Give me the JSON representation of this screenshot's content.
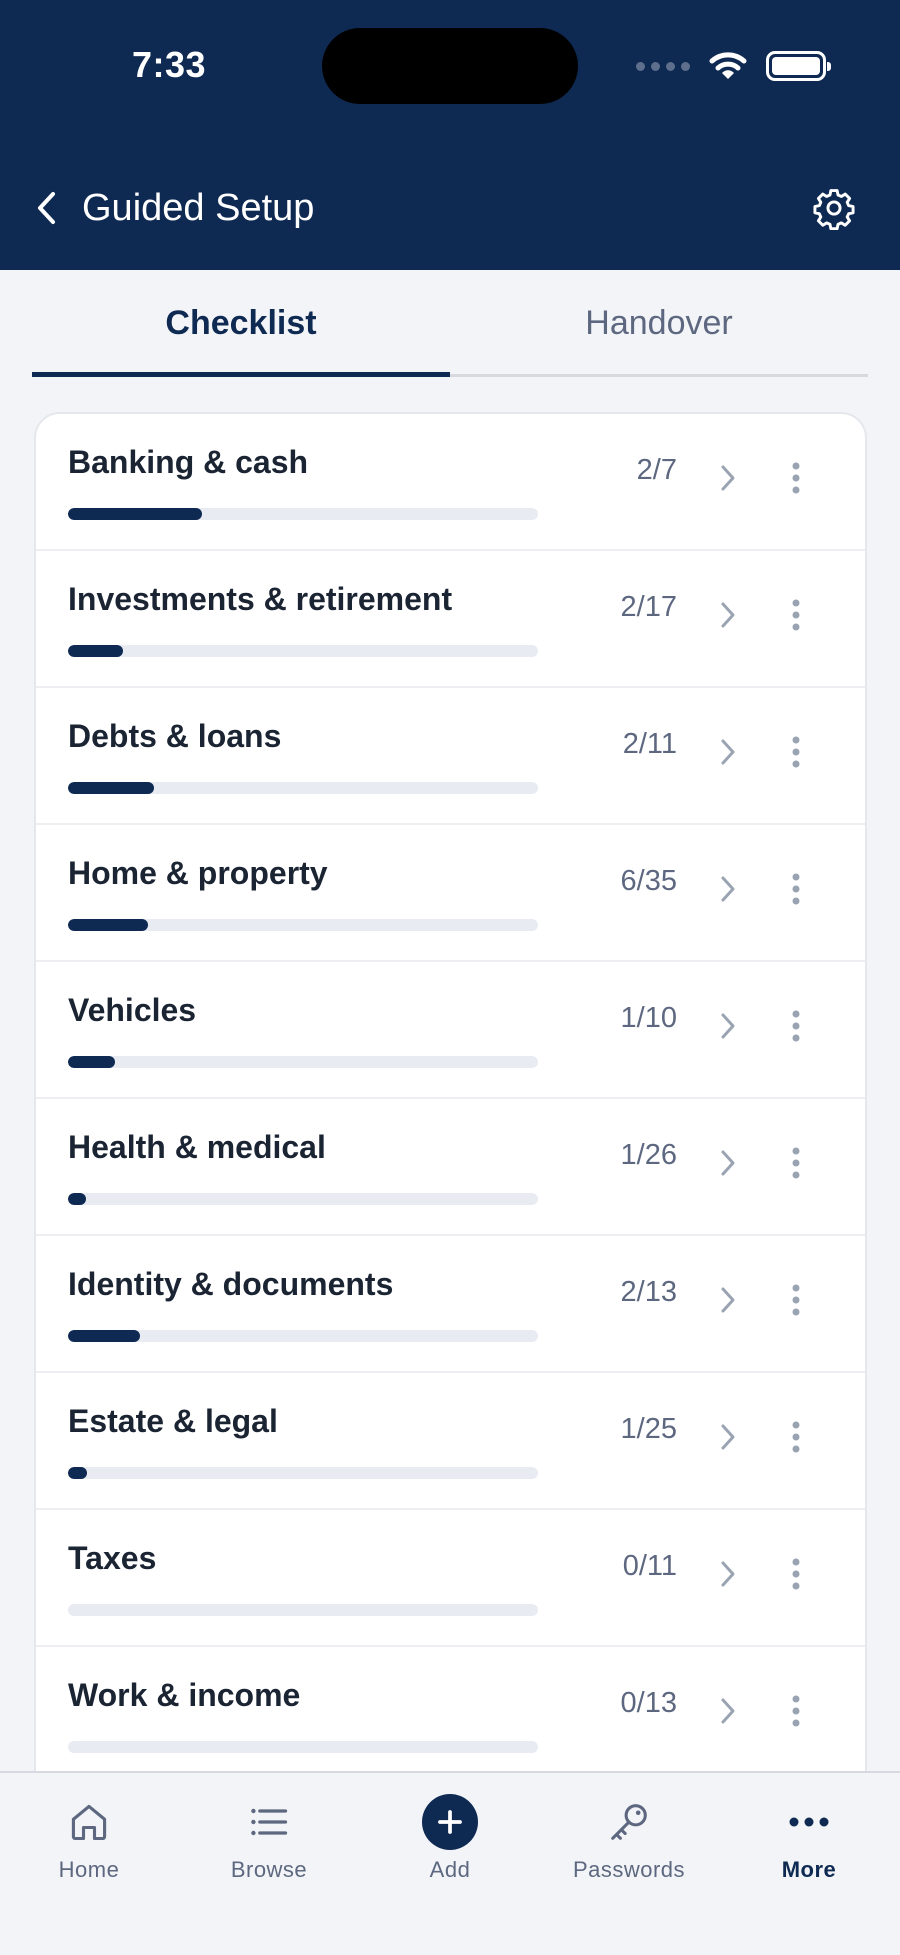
{
  "status_bar": {
    "time": "7:33"
  },
  "header": {
    "title": "Guided Setup"
  },
  "tabs": [
    {
      "label": "Checklist",
      "active": true
    },
    {
      "label": "Handover",
      "active": false
    }
  ],
  "categories": [
    {
      "label": "Banking & cash",
      "count": "2/7",
      "progress": 0.286
    },
    {
      "label": "Investments & retirement",
      "count": "2/17",
      "progress": 0.118
    },
    {
      "label": "Debts & loans",
      "count": "2/11",
      "progress": 0.182
    },
    {
      "label": "Home & property",
      "count": "6/35",
      "progress": 0.171
    },
    {
      "label": "Vehicles",
      "count": "1/10",
      "progress": 0.1
    },
    {
      "label": "Health & medical",
      "count": "1/26",
      "progress": 0.038
    },
    {
      "label": "Identity & documents",
      "count": "2/13",
      "progress": 0.154
    },
    {
      "label": "Estate & legal",
      "count": "1/25",
      "progress": 0.04
    },
    {
      "label": "Taxes",
      "count": "0/11",
      "progress": 0
    },
    {
      "label": "Work & income",
      "count": "0/13",
      "progress": 0
    }
  ],
  "bottom_nav": [
    {
      "label": "Home",
      "icon": "home-icon",
      "active": false
    },
    {
      "label": "Browse",
      "icon": "list-icon",
      "active": false
    },
    {
      "label": "Add",
      "icon": "plus-icon",
      "active": false
    },
    {
      "label": "Passwords",
      "icon": "key-icon",
      "active": false
    },
    {
      "label": "More",
      "icon": "more-icon",
      "active": true
    }
  ],
  "colors": {
    "header_bg": "#0f2a52",
    "accent": "#0f2a52",
    "page_bg": "#f2f4f7",
    "track": "#e8ecf2",
    "muted_text": "#5d6880"
  }
}
